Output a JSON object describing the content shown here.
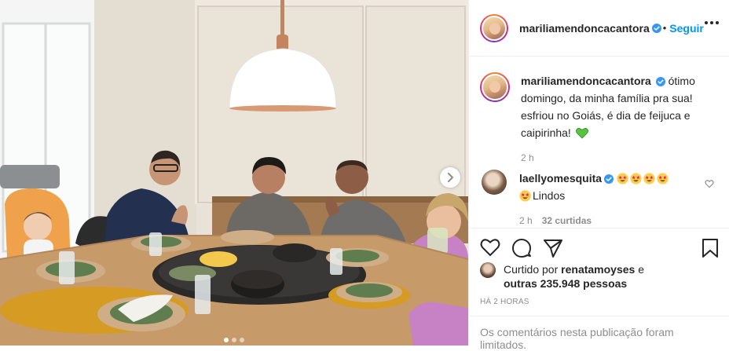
{
  "header": {
    "username": "mariliamendoncacantora",
    "separator": "•",
    "follow_label": "Seguir",
    "more_icon": "more-horizontal-icon"
  },
  "caption": {
    "username": "mariliamendoncacantora",
    "text": "ótimo domingo, da minha família pra sua! esfriou no Goiás, é dia de feijuca e caipirinha!",
    "emoji": "green-heart",
    "time": "2 h"
  },
  "comment": {
    "username": "laellyomesquita",
    "text": "Lindos",
    "emoji": "star-struck",
    "time": "2 h",
    "likes": "32 curtidas"
  },
  "likes": {
    "prefix": "Curtido por",
    "user": "renatamoyses",
    "connector": "e",
    "others": "outras 235.948 pessoas"
  },
  "post_age": "HÁ 2 HORAS",
  "comments_limited": "Os comentários nesta publicação foram limitados.",
  "carousel": {
    "slide_count": 3,
    "active_index": 0
  },
  "colors": {
    "accent": "#0095f6",
    "text": "#262626",
    "muted": "#8e8e8e",
    "divider": "#efefef"
  }
}
